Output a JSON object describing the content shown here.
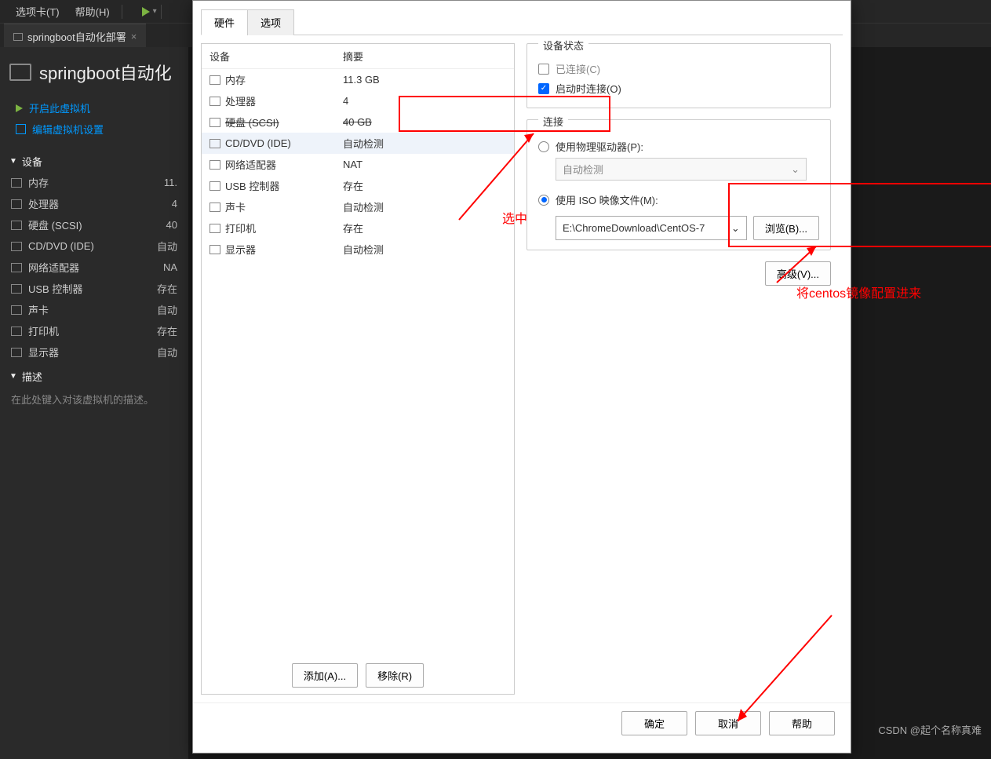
{
  "menubar": {
    "tabs_menu": "选项卡(T)",
    "help_menu": "帮助(H)"
  },
  "tab": {
    "label": "springboot自动化部署",
    "close": "×"
  },
  "sidebar": {
    "title": "springboot自动化",
    "action_start": "开启此虚拟机",
    "action_edit": "编辑虚拟机设置",
    "section_devices": "设备",
    "devices": [
      {
        "name": "内存",
        "val": "11."
      },
      {
        "name": "处理器",
        "val": "4"
      },
      {
        "name": "硬盘 (SCSI)",
        "val": "40 "
      },
      {
        "name": "CD/DVD (IDE)",
        "val": "自动"
      },
      {
        "name": "网络适配器",
        "val": "NA"
      },
      {
        "name": "USB 控制器",
        "val": "存在"
      },
      {
        "name": "声卡",
        "val": "自动"
      },
      {
        "name": "打印机",
        "val": "存在"
      },
      {
        "name": "显示器",
        "val": "自动"
      }
    ],
    "section_desc": "描述",
    "desc_placeholder": "在此处键入对该虚拟机的描述。"
  },
  "dialog": {
    "tab_hw": "硬件",
    "tab_opt": "选项",
    "col_device": "设备",
    "col_summary": "摘要",
    "items": [
      {
        "name": "内存",
        "summary": "11.3 GB"
      },
      {
        "name": "处理器",
        "summary": "4"
      },
      {
        "name": "硬盘 (SCSI)",
        "summary": "40 GB",
        "strike": true
      },
      {
        "name": "CD/DVD (IDE)",
        "summary": "自动检测",
        "selected": true
      },
      {
        "name": "网络适配器",
        "summary": "NAT"
      },
      {
        "name": "USB 控制器",
        "summary": "存在"
      },
      {
        "name": "声卡",
        "summary": "自动检测"
      },
      {
        "name": "打印机",
        "summary": "存在"
      },
      {
        "name": "显示器",
        "summary": "自动检测"
      }
    ],
    "status_title": "设备状态",
    "connected": "已连接(C)",
    "connect_on_start": "启动时连接(O)",
    "conn_title": "连接",
    "use_physical": "使用物理驱动器(P):",
    "auto_detect": "自动检测",
    "use_iso": "使用 ISO 映像文件(M):",
    "iso_path": "E:\\ChromeDownload\\CentOS-7",
    "browse": "浏览(B)...",
    "advanced": "高级(V)...",
    "add": "添加(A)...",
    "remove": "移除(R)",
    "ok": "确定",
    "cancel": "取消",
    "help": "帮助"
  },
  "annotations": {
    "select_text": "选中",
    "centos_text": "将centos镜像配置进来"
  },
  "watermark": "CSDN @起个名称真难"
}
